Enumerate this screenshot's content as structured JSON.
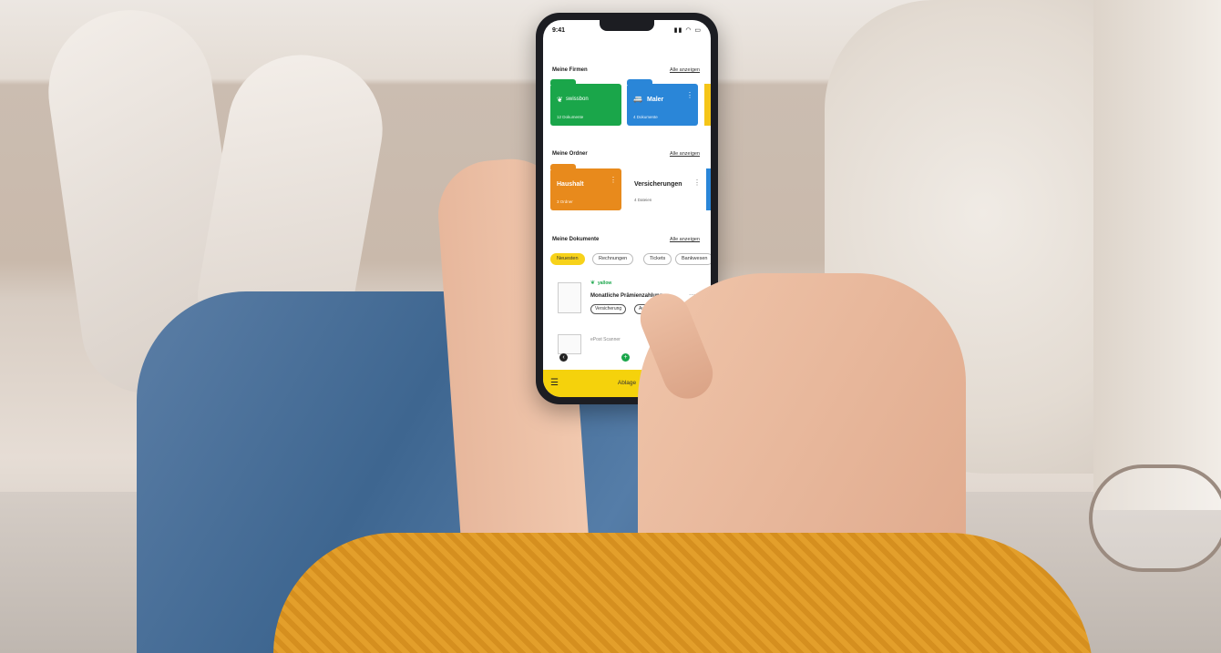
{
  "colors": {
    "accent_yellow": "#f5d20c",
    "folder_green": "#1aa64a",
    "folder_blue": "#2a86d8",
    "folder_orange": "#e88a1c"
  },
  "status": {
    "time": "9:41",
    "icons": "signal-wifi-battery"
  },
  "firms": {
    "title": "Meine Firmen",
    "link": "Alle anzeigen",
    "items": [
      {
        "name": "swissbon",
        "sub": "12 Dokumente",
        "icon": "leaf-logo-icon"
      },
      {
        "name": "Maler",
        "sub": "4 Dokumente",
        "icon": "car-logo-icon"
      }
    ]
  },
  "folders": {
    "title": "Meine Ordner",
    "link": "Alle anzeigen",
    "items": [
      {
        "name": "Haushalt",
        "sub": "3 Ordner"
      },
      {
        "name": "Versicherungen",
        "sub": "4 Dateien"
      }
    ]
  },
  "documents": {
    "title": "Meine Dokumente",
    "link": "Alle anzeigen",
    "filters": [
      "Neuesten",
      "Rechnungen",
      "Tickets",
      "Bankwesen"
    ],
    "items": [
      {
        "brand": "yallow",
        "title": "Monatliche Prämienzahlung",
        "tags": [
          "Versicherung",
          "Auto"
        ]
      },
      {
        "brand": "",
        "title": "ePost Scanner",
        "tags": []
      }
    ]
  },
  "bottom": {
    "label": "Ablage"
  }
}
